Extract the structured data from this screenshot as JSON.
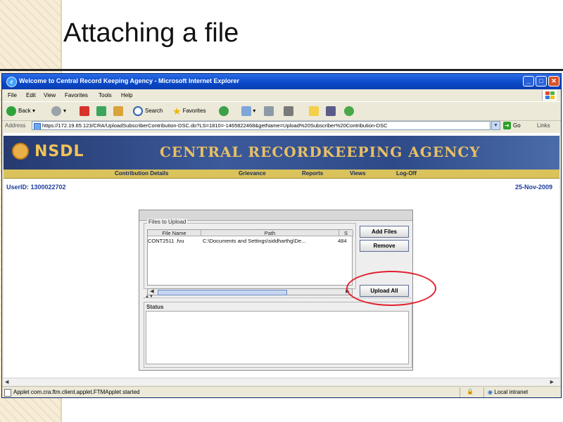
{
  "slide": {
    "title": "Attaching a file"
  },
  "browser": {
    "window_title": "Welcome to Central Record Keeping Agency - Microsoft Internet Explorer",
    "menu": [
      "File",
      "Edit",
      "View",
      "Favorites",
      "Tools",
      "Help"
    ],
    "toolbar": {
      "back": "Back",
      "search": "Search",
      "favorites": "Favorites"
    },
    "address": {
      "label": "Address",
      "url": "https://172.19.65.123/CRA/UploadSubscriberContribution-DSC.do?LS=1810=-1465822468&getName=Upload%20Subscriber%20Contribution-DSC",
      "go": "Go",
      "links": "Links"
    },
    "statusbar": {
      "text": "Applet com.cra.ftm.client.applet.FTMApplet started",
      "zone": "Local intranet"
    }
  },
  "site": {
    "brand": "NSDL",
    "title": "CENTRAL RECORDKEEPING AGENCY",
    "nav": [
      "Contribution Details",
      "Grievance",
      "Reports",
      "Views",
      "Log-Off"
    ],
    "user": "UserID: 1300022702",
    "date": "25-Nov-2009"
  },
  "applet": {
    "files_group_label": "Files to Upload",
    "columns": [
      "File Name",
      "Path",
      "S"
    ],
    "rows": [
      {
        "name": "CONT2511 .fvu",
        "path": "C:\\Documents and Settings\\siddharthg\\De...",
        "size": "484"
      }
    ],
    "buttons": {
      "add": "Add Files",
      "remove": "Remove",
      "upload": "Upload All"
    },
    "status_label": "Status"
  },
  "colors": {
    "annotation": "#e0202c",
    "xp_title": "#0a48c8",
    "banner": "#2e4a88"
  }
}
